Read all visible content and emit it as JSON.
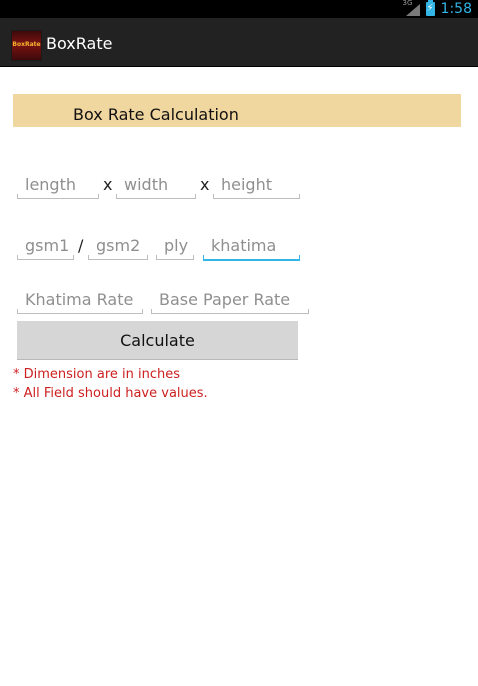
{
  "status_bar": {
    "network": "3G",
    "time": "1:58"
  },
  "app": {
    "title": "BoxRate",
    "logo_text": "BoxRate"
  },
  "header": {
    "title": "Box Rate Calculation"
  },
  "dimensions": {
    "length_placeholder": "length",
    "width_placeholder": "width",
    "height_placeholder": "height",
    "sep1": "x",
    "sep2": "x"
  },
  "paper": {
    "gsm1_placeholder": "gsm1",
    "slash": "/",
    "gsm2_placeholder": "gsm2",
    "ply_placeholder": "ply",
    "khatima_placeholder": "khatima"
  },
  "rates": {
    "khatima_rate_placeholder": "Khatima Rate",
    "base_paper_rate_placeholder": "Base Paper Rate"
  },
  "calculate_label": "Calculate",
  "notes": [
    "* Dimension are in inches",
    "* All Field should have values."
  ],
  "colors": {
    "accent": "#33b5e5",
    "header_band": "#f0d69f",
    "note_text": "#cc1f1f"
  }
}
